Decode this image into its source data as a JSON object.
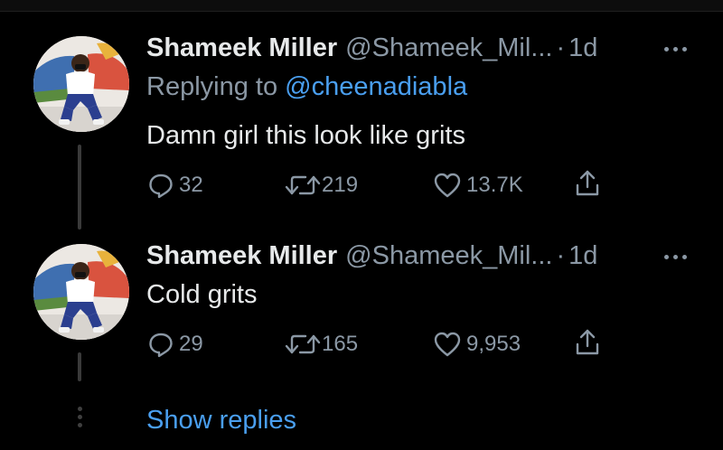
{
  "tweets": [
    {
      "author_name": "Shameek Miller",
      "handle": "@Shameek_Mil...",
      "separator": "·",
      "time": "1d",
      "replying_prefix": "Replying to ",
      "replying_to": "@cheenadiabla",
      "text": "Damn girl this look like grits",
      "replies": "32",
      "retweets": "219",
      "likes": "13.7K"
    },
    {
      "author_name": "Shameek Miller",
      "handle": "@Shameek_Mil...",
      "separator": "·",
      "time": "1d",
      "text": "Cold grits",
      "replies": "29",
      "retweets": "165",
      "likes": "9,953"
    }
  ],
  "show_replies_label": "Show replies",
  "icons": {
    "reply": "reply-icon",
    "retweet": "retweet-icon",
    "like": "heart-icon",
    "share": "share-icon",
    "more": "more-icon"
  },
  "colors": {
    "background": "#000000",
    "primary_text": "#e7e9ea",
    "secondary_text": "#8b98a5",
    "link": "#4a9ff0"
  }
}
